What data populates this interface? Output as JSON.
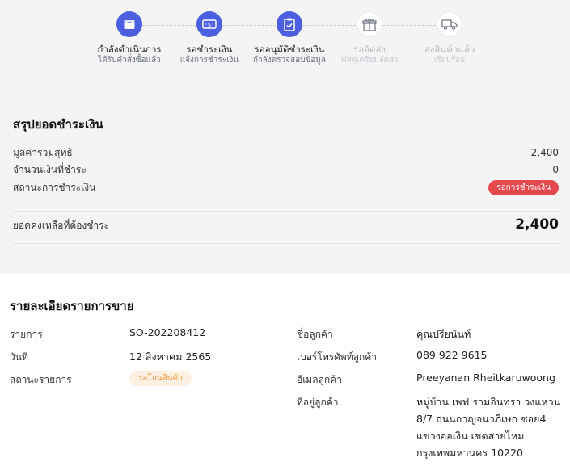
{
  "stepper": {
    "steps": [
      {
        "title": "กำลังดำเนินการ",
        "subtitle": "ได้รับคำสั่งซื้อแล้ว",
        "state": "done",
        "icon": "box-icon"
      },
      {
        "title": "รอชำระเงิน",
        "subtitle": "แจ้งการชำระเงิน",
        "state": "done",
        "icon": "banknote-icon"
      },
      {
        "title": "รออนุมัติชำระเงิน",
        "subtitle": "กำลังตรวจสอบข้อมูล",
        "state": "done",
        "icon": "clipboard-check-icon"
      },
      {
        "title": "รอจัดส่ง",
        "subtitle": "พัสดุเตรียมจัดส่ง",
        "state": "pending",
        "icon": "gift-box-icon"
      },
      {
        "title": "ส่งสินค้าแล้ว",
        "subtitle": "เรียบร้อย",
        "state": "pending",
        "icon": "truck-icon"
      }
    ]
  },
  "summary": {
    "title": "สรุปยอดชำระเงิน",
    "net_total_label": "มูลค่ารวมสุทธิ",
    "net_total_value": "2,400",
    "paid_label": "จำนวนเงินที่ชำระ",
    "paid_value": "0",
    "status_label": "สถานะการชำระเงิน",
    "status_badge": "รอการชำระเงิน",
    "balance_label": "ยอดคงเหลือที่ต้องชำระ",
    "balance_value": "2,400"
  },
  "details": {
    "title": "รายละเอียดรายการขาย",
    "order_label": "รายการ",
    "order_value": "SO-202208412",
    "date_label": "วันที่",
    "date_value": "12 สิงหาคม 2565",
    "status_label": "สถานะรายการ",
    "status_badge": "รอโอนสินค้า",
    "customer_label": "ชื่อลูกค้า",
    "customer_value": "คุณปรียนันท์",
    "phone_label": "เบอร์โทรศัพท์ลูกค้า",
    "phone_value": "089 922 9615",
    "email_label": "อีเมลลูกค้า",
    "email_value": "Preeyanan Rheitkaruwoong",
    "address_label": "ที่อยู่ลูกค้า",
    "address_lines": [
      "หมู่บ้าน เพฟ รามอินทรา วงแหวน",
      "8/7 ถนนกาญจนาภิเษก ซอย4",
      "แขวงออเงิน เขตสายไหม",
      "กรุงเทพมหานคร 10220"
    ]
  },
  "colors": {
    "accent": "#4b5fe0",
    "badge_red": "#e5484d",
    "badge_orange_bg": "#fdf0e1",
    "badge_orange_text": "#f0973f"
  }
}
